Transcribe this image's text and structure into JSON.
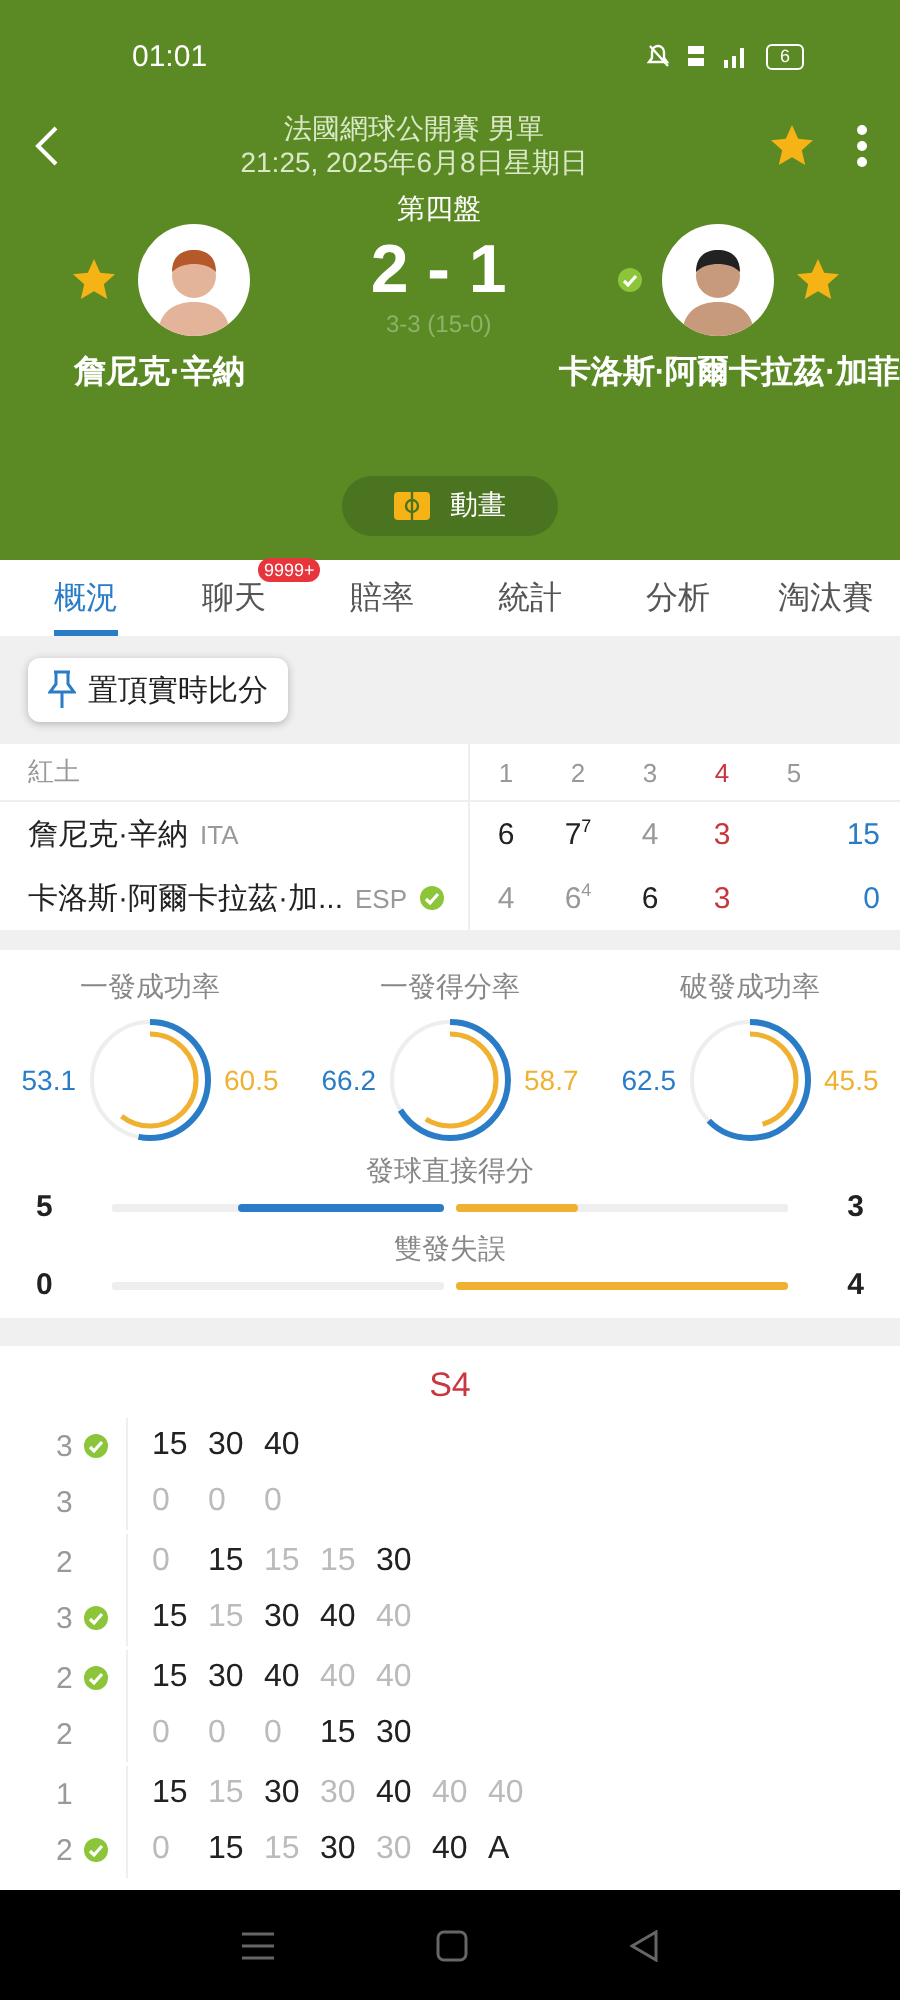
{
  "status_bar": {
    "time": "01:01",
    "battery": "6"
  },
  "header": {
    "title": "法國網球公開賽 男單",
    "date": "21:25, 2025年6月8日星期日",
    "favorite": true,
    "set_label": "第四盤",
    "score": "2 - 1",
    "game_score": "3-3 (15-0)",
    "players": [
      {
        "name": "詹尼克·辛納",
        "favorite": true,
        "serving": false
      },
      {
        "name": "卡洛斯·阿爾卡拉茲·加菲",
        "favorite": true,
        "serving": true
      }
    ],
    "animation_button": "動畫"
  },
  "tabs": [
    {
      "label": "概況",
      "selected": true
    },
    {
      "label": "聊天",
      "selected": false,
      "badge": "9999+"
    },
    {
      "label": "賠率",
      "selected": false
    },
    {
      "label": "統計",
      "selected": false
    },
    {
      "label": "分析",
      "selected": false
    },
    {
      "label": "淘汰賽",
      "selected": false
    }
  ],
  "pin_button": "置頂實時比分",
  "score_table": {
    "surface": "紅土",
    "sets": [
      {
        "label": "1",
        "current": false
      },
      {
        "label": "2",
        "current": false
      },
      {
        "label": "3",
        "current": false
      },
      {
        "label": "4",
        "current": true
      },
      {
        "label": "5",
        "current": false
      }
    ],
    "rows": [
      {
        "name": "詹尼克·辛納",
        "country": "ITA",
        "serving": false,
        "sets": [
          {
            "score": "6",
            "won": true
          },
          {
            "score": "7",
            "tiebreak": "7",
            "won": true
          },
          {
            "score": "4",
            "won": false
          },
          {
            "score": "3",
            "won": false
          }
        ],
        "points": "15"
      },
      {
        "name": "卡洛斯·阿爾卡拉茲·加...",
        "country": "ESP",
        "serving": true,
        "sets": [
          {
            "score": "4",
            "won": false
          },
          {
            "score": "6",
            "tiebreak": "4",
            "won": false
          },
          {
            "score": "6",
            "won": true
          },
          {
            "score": "3",
            "won": false
          }
        ],
        "points": "0"
      }
    ]
  },
  "stats": {
    "rings": [
      {
        "label": "一發成功率",
        "left": {
          "value": "53.1",
          "level": 0.531
        },
        "right": {
          "value": "60.5",
          "level": 0.605
        }
      },
      {
        "label": "一發得分率",
        "left": {
          "value": "66.2",
          "level": 0.662
        },
        "right": {
          "value": "58.7",
          "level": 0.587
        }
      },
      {
        "label": "破發成功率",
        "left": {
          "value": "62.5",
          "level": 0.625
        },
        "right": {
          "value": "45.5",
          "level": 0.455
        }
      }
    ],
    "bars": [
      {
        "label": "發球直接得分",
        "left": {
          "value": "5",
          "level": 0.62
        },
        "right": {
          "value": "3",
          "level": 0.37
        }
      },
      {
        "label": "雙發失誤",
        "left": {
          "value": "0",
          "level": 0
        },
        "right": {
          "value": "4",
          "level": 1
        }
      }
    ]
  },
  "point_by_point": {
    "set": "S4",
    "games": [
      {
        "rows": [
          {
            "games": "3",
            "serving": true,
            "points": [
              {
                "text": "15",
                "active": true
              },
              {
                "text": "30",
                "active": true
              },
              {
                "text": "40",
                "active": true
              }
            ]
          },
          {
            "games": "3",
            "serving": false,
            "points": [
              {
                "text": "0",
                "active": false
              },
              {
                "text": "0",
                "active": false
              },
              {
                "text": "0",
                "active": false
              }
            ]
          }
        ]
      },
      {
        "rows": [
          {
            "games": "2",
            "serving": false,
            "points": [
              {
                "text": "0",
                "active": false
              },
              {
                "text": "15",
                "active": true
              },
              {
                "text": "15",
                "active": false
              },
              {
                "text": "15",
                "active": false
              },
              {
                "text": "30",
                "active": true
              }
            ]
          },
          {
            "games": "3",
            "serving": true,
            "points": [
              {
                "text": "15",
                "active": true
              },
              {
                "text": "15",
                "active": false
              },
              {
                "text": "30",
                "active": true
              },
              {
                "text": "40",
                "active": true
              },
              {
                "text": "40",
                "active": false
              }
            ]
          }
        ]
      },
      {
        "rows": [
          {
            "games": "2",
            "serving": true,
            "points": [
              {
                "text": "15",
                "active": true
              },
              {
                "text": "30",
                "active": true
              },
              {
                "text": "40",
                "active": true
              },
              {
                "text": "40",
                "active": false
              },
              {
                "text": "40",
                "active": false
              }
            ]
          },
          {
            "games": "2",
            "serving": false,
            "points": [
              {
                "text": "0",
                "active": false
              },
              {
                "text": "0",
                "active": false
              },
              {
                "text": "0",
                "active": false
              },
              {
                "text": "15",
                "active": true
              },
              {
                "text": "30",
                "active": true
              }
            ]
          }
        ]
      },
      {
        "rows": [
          {
            "games": "1",
            "serving": false,
            "points": [
              {
                "text": "15",
                "active": true
              },
              {
                "text": "15",
                "active": false
              },
              {
                "text": "30",
                "active": true
              },
              {
                "text": "30",
                "active": false
              },
              {
                "text": "40",
                "active": true
              },
              {
                "text": "40",
                "active": false
              },
              {
                "text": "40",
                "active": false
              }
            ]
          },
          {
            "games": "2",
            "serving": true,
            "points": [
              {
                "text": "0",
                "active": false
              },
              {
                "text": "15",
                "active": true
              },
              {
                "text": "15",
                "active": false
              },
              {
                "text": "30",
                "active": true
              },
              {
                "text": "30",
                "active": false
              },
              {
                "text": "40",
                "active": true
              },
              {
                "text": "A",
                "active": true
              }
            ]
          }
        ]
      }
    ]
  }
}
